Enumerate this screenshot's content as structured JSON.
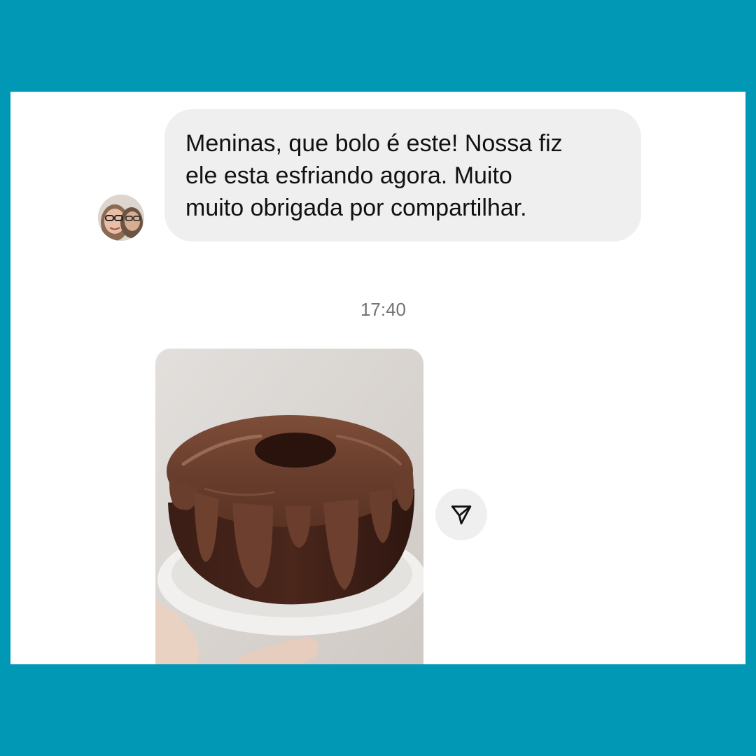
{
  "colors": {
    "frame": "#0098b5",
    "card": "#ffffff",
    "bubble": "#efefef",
    "text": "#111111",
    "timestamp": "#737373"
  },
  "message": {
    "sender_avatar": "avatar-photo",
    "lines": [
      "Meninas, que bolo é  este! Nossa fiz",
      "ele esta esfriando agora. Muito",
      "muito obrigada por compartilhar."
    ]
  },
  "timestamp": "17:40",
  "photo_message": {
    "subject": "chocolate bundt cake with glaze on a white plate",
    "share_icon": "send-icon"
  }
}
